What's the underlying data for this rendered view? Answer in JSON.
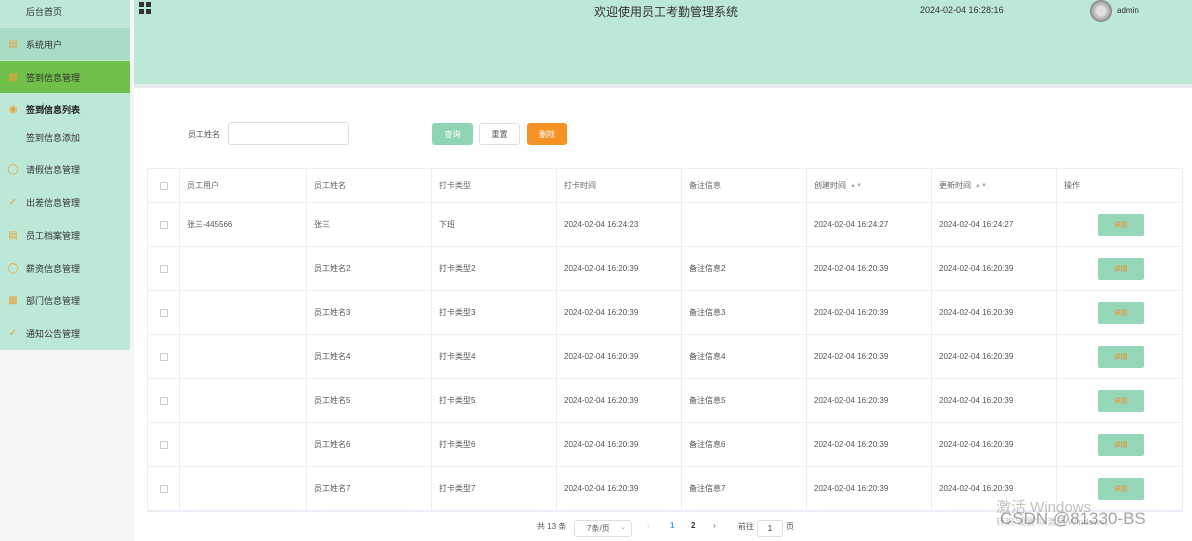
{
  "header": {
    "title": "欢迎使用员工考勤管理系统",
    "datetime": "2024-02-04 16:28:16",
    "username": "admin"
  },
  "sidebar": {
    "items": [
      {
        "label": "后台首页",
        "icon": "none"
      },
      {
        "label": "系统用户",
        "icon": "document-icon"
      },
      {
        "label": "签到信息管理",
        "icon": "bar-chart-icon"
      },
      {
        "label": "签到信息列表",
        "icon": "location-pin-icon"
      },
      {
        "label": "签到信息添加",
        "icon": "none"
      },
      {
        "label": "请假信息管理",
        "icon": "chat-icon"
      },
      {
        "label": "出差信息管理",
        "icon": "check-circle-icon"
      },
      {
        "label": "员工档案管理",
        "icon": "document-icon"
      },
      {
        "label": "薪资信息管理",
        "icon": "chat-icon"
      },
      {
        "label": "部门信息管理",
        "icon": "bar-chart-icon"
      },
      {
        "label": "通知公告管理",
        "icon": "check-circle-icon"
      }
    ]
  },
  "search": {
    "label": "员工姓名",
    "value": "",
    "query_label": "查询",
    "reset_label": "重置",
    "delete_label": "删除"
  },
  "table": {
    "headers": [
      "员工用户",
      "员工姓名",
      "打卡类型",
      "打卡时间",
      "备注信息",
      "创建时间",
      "更新时间",
      "操作"
    ],
    "detail_label": "详情",
    "rows": [
      [
        "张三-445566",
        "张三",
        "下班",
        "2024-02-04 16:24:23",
        "",
        "2024-02-04 16:24:27",
        "2024-02-04 16:24:27"
      ],
      [
        "",
        "员工姓名2",
        "打卡类型2",
        "2024-02-04 16:20:39",
        "备注信息2",
        "2024-02-04 16:20:39",
        "2024-02-04 16:20:39"
      ],
      [
        "",
        "员工姓名3",
        "打卡类型3",
        "2024-02-04 16:20:39",
        "备注信息3",
        "2024-02-04 16:20:39",
        "2024-02-04 16:20:39"
      ],
      [
        "",
        "员工姓名4",
        "打卡类型4",
        "2024-02-04 16:20:39",
        "备注信息4",
        "2024-02-04 16:20:39",
        "2024-02-04 16:20:39"
      ],
      [
        "",
        "员工姓名5",
        "打卡类型5",
        "2024-02-04 16:20:39",
        "备注信息5",
        "2024-02-04 16:20:39",
        "2024-02-04 16:20:39"
      ],
      [
        "",
        "员工姓名6",
        "打卡类型6",
        "2024-02-04 16:20:39",
        "备注信息6",
        "2024-02-04 16:20:39",
        "2024-02-04 16:20:39"
      ],
      [
        "",
        "员工姓名7",
        "打卡类型7",
        "2024-02-04 16:20:39",
        "备注信息7",
        "2024-02-04 16:20:39",
        "2024-02-04 16:20:39"
      ]
    ]
  },
  "pagination": {
    "total": "共 13 条",
    "page_size": "7条/页",
    "page1": "1",
    "page2": "2",
    "goto_label": "前往",
    "goto_value": "1",
    "page_suffix": "页"
  },
  "watermark": {
    "activate_title": "激活 Windows",
    "activate_sub": "转到\"设置\"以激活 Windows。",
    "csdn": "CSDN @81330-BS"
  },
  "colors": {
    "theme_green": "#bde7d6",
    "active_green": "#6fbf4a",
    "delete_orange": "#f39225",
    "button_green": "#8fd4b4"
  }
}
